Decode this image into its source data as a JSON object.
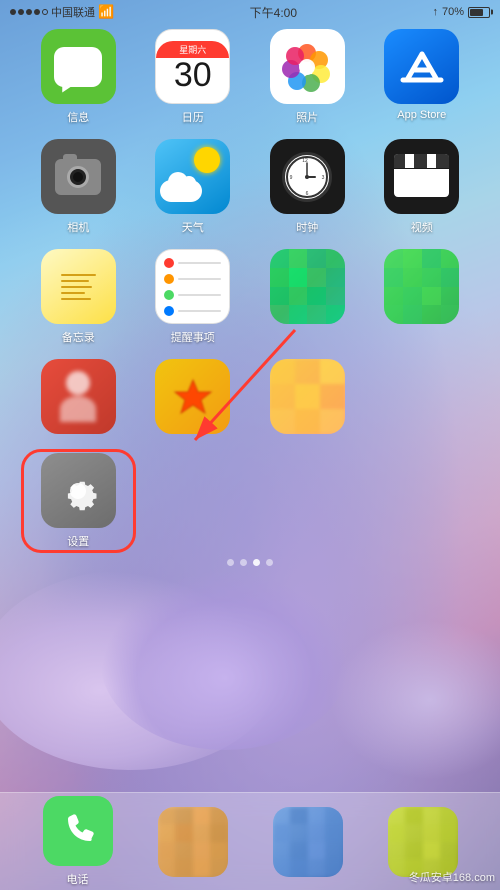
{
  "status_bar": {
    "carrier": "中国联通",
    "wifi": "wifi",
    "time": "下午4:00",
    "arrow": "↑",
    "battery_percent": "70%"
  },
  "apps": {
    "row1": [
      {
        "id": "messages",
        "label": "信息",
        "type": "messages"
      },
      {
        "id": "calendar",
        "label": "日历",
        "type": "calendar",
        "day": "星期六",
        "date": "30"
      },
      {
        "id": "photos",
        "label": "照片",
        "type": "photos"
      },
      {
        "id": "appstore",
        "label": "App Store",
        "type": "appstore"
      }
    ],
    "row2": [
      {
        "id": "camera",
        "label": "相机",
        "type": "camera"
      },
      {
        "id": "weather",
        "label": "天气",
        "type": "weather"
      },
      {
        "id": "clock",
        "label": "时钟",
        "type": "clock"
      },
      {
        "id": "videos",
        "label": "视频",
        "type": "videos"
      }
    ],
    "row3": [
      {
        "id": "notes",
        "label": "备忘录",
        "type": "notes"
      },
      {
        "id": "reminders",
        "label": "提醒事项",
        "type": "reminders"
      },
      {
        "id": "pix1",
        "label": "",
        "type": "pix-green"
      },
      {
        "id": "pix2",
        "label": "",
        "type": "pix-green2"
      }
    ],
    "row4": [
      {
        "id": "pix3",
        "label": "",
        "type": "pix-red"
      },
      {
        "id": "pix4",
        "label": "",
        "type": "pix-star"
      },
      {
        "id": "pix5",
        "label": "",
        "type": "pix-yellow"
      },
      {
        "id": "pix6",
        "label": "",
        "type": "pix-empty"
      }
    ],
    "row5": [
      {
        "id": "settings",
        "label": "设置",
        "type": "settings",
        "highlighted": true
      },
      {
        "id": "empty1",
        "label": "",
        "type": "empty"
      },
      {
        "id": "empty2",
        "label": "",
        "type": "empty"
      },
      {
        "id": "empty3",
        "label": "",
        "type": "empty"
      }
    ]
  },
  "page_dots": [
    {
      "active": false
    },
    {
      "active": false
    },
    {
      "active": true
    },
    {
      "active": false
    }
  ],
  "dock": {
    "apps": [
      {
        "id": "phone",
        "label": "电话",
        "type": "phone"
      },
      {
        "id": "dock2",
        "label": "",
        "type": "pix-dock2"
      },
      {
        "id": "dock3",
        "label": "",
        "type": "pix-dock3"
      },
      {
        "id": "dock4",
        "label": "",
        "type": "pix-dock4"
      }
    ]
  },
  "watermark": "冬瓜安卓168.com",
  "arrow_annotation": {
    "visible": true
  }
}
